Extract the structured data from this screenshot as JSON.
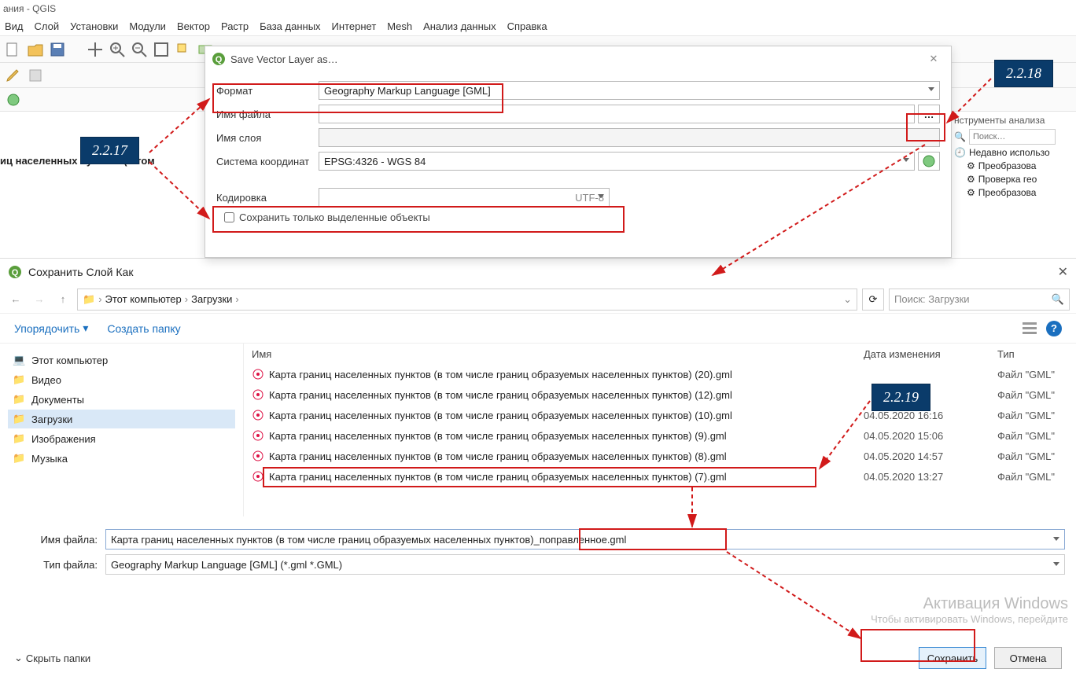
{
  "app": {
    "title_fragment": "ания - QGIS"
  },
  "menu": [
    "Вид",
    "Слой",
    "Установки",
    "Модули",
    "Вектор",
    "Растр",
    "База данных",
    "Интернет",
    "Mesh",
    "Анализ данных",
    "Справка"
  ],
  "layer_panel_label": "иц населенных пунктов (в том",
  "right_panel": {
    "header": "нструменты анализа",
    "search_placeholder": "Поиск…",
    "items": [
      "Недавно использо",
      "Преобразова",
      "Проверка гео",
      "Преобразова"
    ]
  },
  "svl": {
    "title": "Save Vector Layer as…",
    "format_label": "Формат",
    "format_value": "Geography Markup Language [GML]",
    "filename_label": "Имя файла",
    "filename_value": "",
    "browse": "…",
    "layername_label": "Имя слоя",
    "layername_value": "",
    "crs_label": "Система координат",
    "crs_value": "EPSG:4326 - WGS 84",
    "encoding_label": "Кодировка",
    "encoding_value": "UTF-8",
    "checkbox_label": "Сохранить только выделенные объекты"
  },
  "callouts": {
    "a": "2.2.17",
    "b": "2.2.18",
    "c": "2.2.19"
  },
  "sf": {
    "title": "Сохранить Слой Как",
    "breadcrumb": [
      "Этот компьютер",
      "Загрузки"
    ],
    "search_placeholder": "Поиск: Загрузки",
    "organize": "Упорядочить",
    "new_folder": "Создать папку",
    "sidebar": [
      {
        "label": "Этот компьютер",
        "icon": "pc"
      },
      {
        "label": "Видео",
        "icon": "folder"
      },
      {
        "label": "Документы",
        "icon": "folder"
      },
      {
        "label": "Загрузки",
        "icon": "folder",
        "selected": true
      },
      {
        "label": "Изображения",
        "icon": "folder"
      },
      {
        "label": "Музыка",
        "icon": "folder"
      }
    ],
    "columns": {
      "name": "Имя",
      "date": "Дата изменения",
      "type": "Тип"
    },
    "rows": [
      {
        "name": "Карта границ населенных пунктов (в том числе границ образуемых населенных пунктов) (20).gml",
        "date": "",
        "type": "Файл \"GML\""
      },
      {
        "name": "Карта границ населенных пунктов (в том числе границ образуемых населенных пунктов) (12).gml",
        "date": "",
        "type": "Файл \"GML\""
      },
      {
        "name": "Карта границ населенных пунктов (в том числе границ образуемых населенных пунктов) (10).gml",
        "date": "04.05.2020 16:16",
        "type": "Файл \"GML\""
      },
      {
        "name": "Карта границ населенных пунктов (в том числе границ образуемых населенных пунктов) (9).gml",
        "date": "04.05.2020 15:06",
        "type": "Файл \"GML\""
      },
      {
        "name": "Карта границ населенных пунктов (в том числе границ образуемых населенных пунктов) (8).gml",
        "date": "04.05.2020 14:57",
        "type": "Файл \"GML\""
      },
      {
        "name": "Карта границ населенных пунктов (в том числе границ образуемых населенных пунктов) (7).gml",
        "date": "04.05.2020 13:27",
        "type": "Файл \"GML\""
      }
    ],
    "filename_label": "Имя файла:",
    "filename_value": "Карта границ населенных пунктов (в том числе границ образуемых населенных пунктов)_поправленное.gml",
    "filetype_label": "Тип файла:",
    "filetype_value": "Geography Markup Language [GML] (*.gml *.GML)",
    "hide_folders": "Скрыть папки",
    "save": "Сохранить",
    "cancel": "Отмена"
  },
  "watermark": {
    "line1": "Активация Windows",
    "line2": "Чтобы активировать Windows, перейдите"
  }
}
